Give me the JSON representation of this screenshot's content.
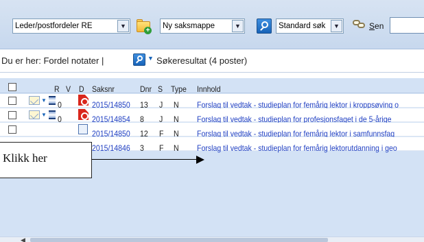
{
  "toolbar": {
    "role_select": "Leder/postfordeler RE",
    "folder_select": "Ny saksmappe",
    "search_select": "Standard søk",
    "send_label_underlined": "S",
    "send_label_rest": "en",
    "send_input_value": ""
  },
  "breadcrumb": {
    "prefix": "Du er her:",
    "page": "Fordel notater",
    "separator": "|",
    "result": "Søkeresultat (4 poster)"
  },
  "table": {
    "headers": {
      "r": "R",
      "v": "V",
      "d": "D",
      "saksnr": "Saksnr",
      "dnr": "Dnr",
      "s": "S",
      "type": "Type",
      "innhold": "Innhold"
    },
    "rows": [
      {
        "v": "0",
        "saksnr": "2015/14850",
        "dnr": "13",
        "s": "J",
        "type": "N",
        "innhold": "Forslag til vedtak - studieplan for femårig lektor i kroppsøving o"
      },
      {
        "v": "0",
        "saksnr": "2015/14854",
        "dnr": "8",
        "s": "J",
        "type": "N",
        "innhold": "Forslag til vedtak - studieplan for profesjonsfaget i de 5-årige"
      },
      {
        "v": "",
        "saksnr": "2015/14850",
        "dnr": "12",
        "s": "F",
        "type": "N",
        "innhold": "Forslag til vedtak - studieplan for femårig lektor i samfunnsfag"
      },
      {
        "v": "",
        "saksnr": "2015/14846",
        "dnr": "3",
        "s": "F",
        "type": "N",
        "innhold": "Forslag til vedtak - studieplan for femårig lektorutdanning i geo"
      }
    ]
  },
  "callout": {
    "text": "Klikk her"
  },
  "icons": {
    "folder": "new-folder-icon",
    "search": "search-icon",
    "send": "send-icon",
    "mail": "mail-icon",
    "hourglass": "hourglass-icon",
    "pdf": "pdf-icon",
    "document": "document-icon"
  },
  "colors": {
    "link": "#1f3fc2",
    "toolbar_bg": "#d7e3f2",
    "table_bg": "#d3e2f5",
    "pdf": "#d9261c"
  }
}
